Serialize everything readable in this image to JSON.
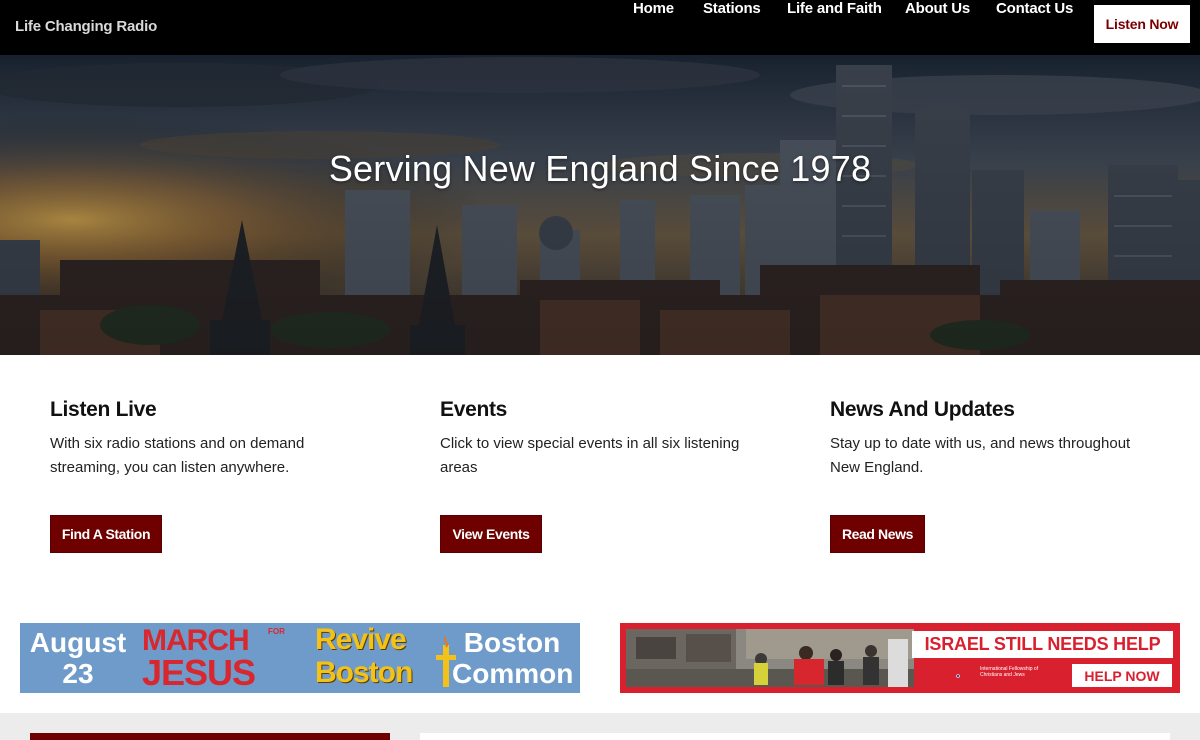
{
  "site": {
    "brand": "Life Changing Radio"
  },
  "nav": {
    "items": [
      {
        "label": "Home"
      },
      {
        "label": "Stations"
      },
      {
        "label": "Life and Faith"
      },
      {
        "label": "About Us"
      },
      {
        "label": "Contact Us"
      }
    ],
    "listen_now": "Listen Now"
  },
  "hero": {
    "title": "Serving New England Since 1978"
  },
  "features": [
    {
      "title": "Listen Live",
      "text": "With six radio stations and on demand streaming, you can listen anywhere.",
      "button": "Find A Station"
    },
    {
      "title": "Events",
      "text": "Click to view special events in all six listening areas",
      "button": "View Events"
    },
    {
      "title": "News And Updates",
      "text": "Stay up to date with us, and news throughout New England.",
      "button": "Read News"
    }
  ],
  "banners": {
    "march": {
      "date_month": "August",
      "date_day": "23",
      "march": "MARCH",
      "for": "FOR",
      "jesus": "JESUS",
      "revive": "Revive",
      "boston": "Boston",
      "place_1": "Boston",
      "place_2": "Common"
    },
    "israel": {
      "headline": "ISRAEL STILL NEEDS HELP",
      "org": "International Fellowship of Christians and Jews",
      "cta": "HELP NOW"
    }
  },
  "colors": {
    "accent": "#6e0000",
    "nav_bg": "#000000",
    "israel_red": "#d8202f",
    "march_blue": "#6e9bc9",
    "revive_gold": "#f3c21a"
  }
}
